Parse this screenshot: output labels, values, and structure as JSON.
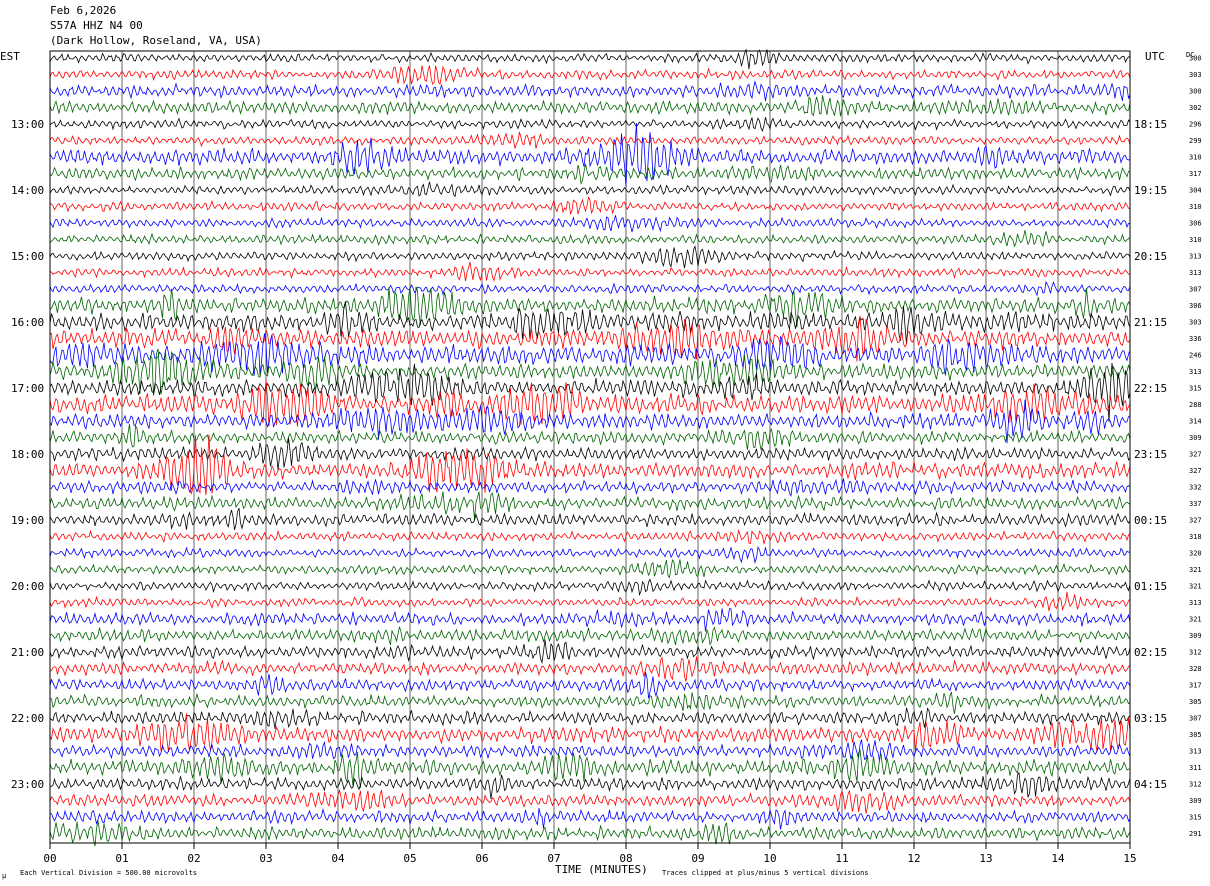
{
  "header": {
    "date": "Feb 6,2026",
    "station": "S57A HHZ N4 00",
    "location": "(Dark Hollow, Roseland, VA, USA)"
  },
  "chart_data": {
    "type": "line",
    "title": "Feb 6,2026",
    "left_axis_label": "EST",
    "right_axis_label": "UTC",
    "dc_label": "DC",
    "xlabel": "TIME (MINUTES)",
    "xlim": [
      0,
      15
    ],
    "x_ticks": [
      "00",
      "01",
      "02",
      "03",
      "04",
      "05",
      "06",
      "07",
      "08",
      "09",
      "10",
      "11",
      "12",
      "13",
      "14",
      "15"
    ],
    "trace_count": 48,
    "trace_colors": [
      "#000000",
      "#ff0000",
      "#0000ff",
      "#006400"
    ],
    "est_hour_labels": [
      {
        "trace": 4,
        "label": "13:00"
      },
      {
        "trace": 8,
        "label": "14:00"
      },
      {
        "trace": 12,
        "label": "15:00"
      },
      {
        "trace": 16,
        "label": "16:00"
      },
      {
        "trace": 20,
        "label": "17:00"
      },
      {
        "trace": 24,
        "label": "18:00"
      },
      {
        "trace": 28,
        "label": "19:00"
      },
      {
        "trace": 32,
        "label": "20:00"
      },
      {
        "trace": 36,
        "label": "21:00"
      },
      {
        "trace": 40,
        "label": "22:00"
      },
      {
        "trace": 44,
        "label": "23:00"
      }
    ],
    "utc_hour_labels": [
      {
        "trace": 4,
        "label": "18:15"
      },
      {
        "trace": 8,
        "label": "19:15"
      },
      {
        "trace": 12,
        "label": "20:15"
      },
      {
        "trace": 16,
        "label": "21:15"
      },
      {
        "trace": 20,
        "label": "22:15"
      },
      {
        "trace": 24,
        "label": "23:15"
      },
      {
        "trace": 28,
        "label": "00:15"
      },
      {
        "trace": 32,
        "label": "01:15"
      },
      {
        "trace": 36,
        "label": "02:15"
      },
      {
        "trace": 40,
        "label": "03:15"
      },
      {
        "trace": 44,
        "label": "04:15"
      }
    ],
    "dc_offsets": [
      300,
      303,
      300,
      302,
      296,
      299,
      310,
      317,
      304,
      310,
      306,
      310,
      313,
      313,
      307,
      306,
      303,
      336,
      246,
      313,
      315,
      288,
      314,
      309,
      327,
      327,
      332,
      337,
      327,
      318,
      320,
      321,
      321,
      313,
      321,
      309,
      312,
      328,
      317,
      305,
      307,
      305,
      313,
      311,
      312,
      309,
      315,
      291
    ],
    "trace_activity": [
      1,
      1,
      2,
      2,
      1,
      1,
      3,
      2,
      1,
      1,
      1,
      1,
      1,
      1,
      1,
      3,
      4,
      4,
      4,
      3,
      3,
      4,
      3,
      2,
      2,
      3,
      2,
      2,
      2,
      1,
      1,
      1,
      1,
      1,
      2,
      2,
      2,
      2,
      2,
      2,
      2,
      3,
      2,
      3,
      2,
      2,
      2,
      2
    ],
    "footer_left": "Each Vertical Division =  500.00 microvolts",
    "footer_right": "Traces clipped at plus/minus 5 vertical divisions",
    "corner_mark": "μ"
  }
}
